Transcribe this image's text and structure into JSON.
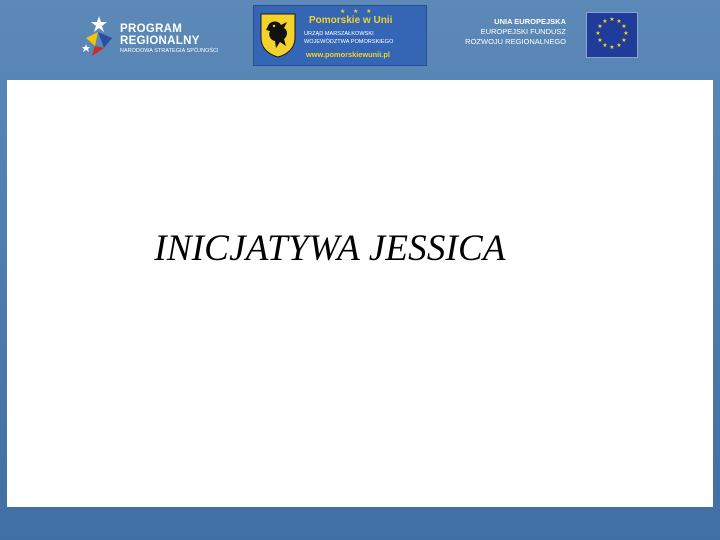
{
  "logos": {
    "program_regionalny": {
      "line1": "PROGRAM",
      "line2": "REGIONALNY",
      "subtitle": "NARODOWA STRATEGIA SPÓJNOŚCI"
    },
    "pomorskie": {
      "title": "Pomorskie w Unii",
      "line1": "URZĄD MARSZAŁKOWSKI",
      "line2": "WOJEWÓDZTWA POMORSKIEGO",
      "url": "www.pomorskiewunii.pl"
    },
    "eu": {
      "line1": "UNIA EUROPEJSKA",
      "line2": "EUROPEJSKI FUNDUSZ",
      "line3": "ROZWOJU REGIONALNEGO"
    }
  },
  "slide": {
    "title": "INICJATYWA JESSICA"
  },
  "colors": {
    "background": "#4c7bad",
    "panel": "#ffffff",
    "gold": "#f2d22b",
    "eu_blue": "#1f3c9a"
  }
}
